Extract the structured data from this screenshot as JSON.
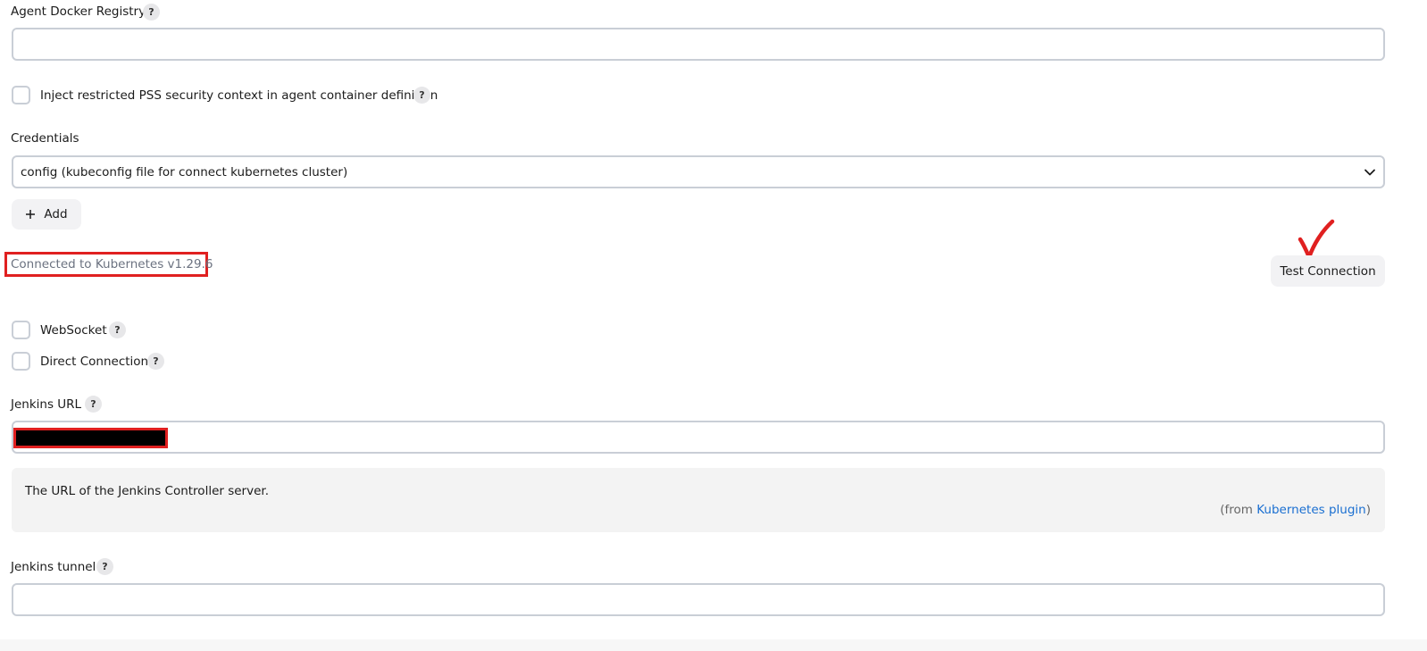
{
  "agent_docker_registry": {
    "label": "Agent Docker Registry",
    "value": ""
  },
  "inject_pss": {
    "label": "Inject restricted PSS security context in agent container definition",
    "checked": false
  },
  "credentials": {
    "label": "Credentials",
    "selected": "config (kubeconfig file for connect kubernetes cluster)",
    "add_label": "Add"
  },
  "connection": {
    "status": "Connected to Kubernetes v1.29.6",
    "test_label": "Test Connection"
  },
  "websocket": {
    "label": "WebSocket",
    "checked": false
  },
  "direct_connection": {
    "label": "Direct Connection",
    "checked": false
  },
  "jenkins_url": {
    "label": "Jenkins URL",
    "help_text": "The URL of the Jenkins Controller server.",
    "from_prefix": "(from ",
    "from_link": "Kubernetes plugin",
    "from_suffix": ")"
  },
  "jenkins_tunnel": {
    "label": "Jenkins tunnel",
    "value": ""
  },
  "help_glyph": "?",
  "colors": {
    "accent_red": "#e02020",
    "link": "#1a6fd1",
    "border": "#c9ced6"
  }
}
